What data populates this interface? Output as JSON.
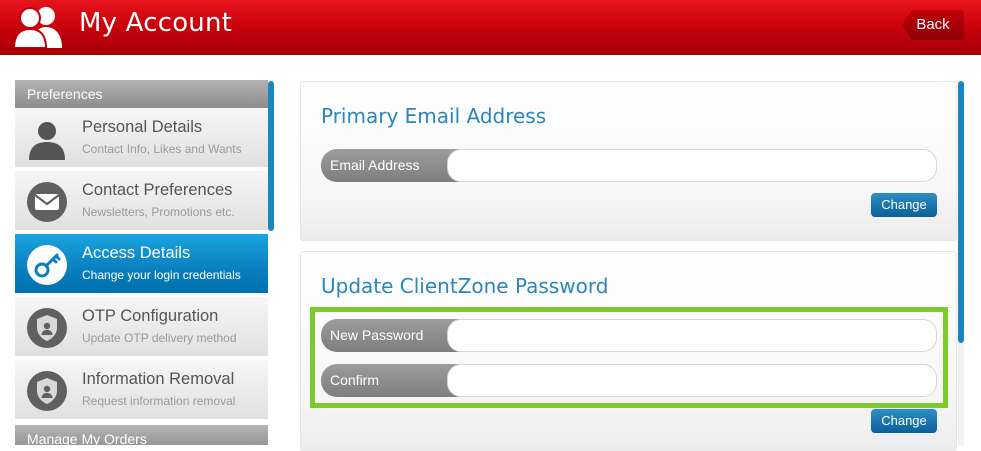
{
  "header": {
    "title": "My Account",
    "icon": "users-icon",
    "back_label": "Back"
  },
  "sidebar": {
    "section_title": "Preferences",
    "items": [
      {
        "label": "Personal Details",
        "sub": "Contact Info, Likes and Wants",
        "icon": "person-icon",
        "active": false
      },
      {
        "label": "Contact Preferences",
        "sub": "Newsletters, Promotions etc.",
        "icon": "envelope-icon",
        "active": false
      },
      {
        "label": "Access Details",
        "sub": "Change your login credentials",
        "icon": "key-icon",
        "active": true
      },
      {
        "label": "OTP Configuration",
        "sub": "Update OTP delivery method",
        "icon": "shield-icon",
        "active": false
      },
      {
        "label": "Information Removal",
        "sub": "Request information removal",
        "icon": "shield-icon",
        "active": false
      }
    ],
    "next_section_title": "Manage My Orders"
  },
  "email_panel": {
    "title": "Primary Email Address",
    "email_label": "Email Address",
    "email_value": "",
    "change_label": "Change"
  },
  "password_panel": {
    "title": "Update ClientZone Password",
    "new_password_label": "New Password",
    "new_password_value": "",
    "confirm_label": "Confirm",
    "confirm_value": "",
    "change_label": "Change"
  },
  "colors": {
    "header_red": "#c4000a",
    "accent_blue": "#1a8fd0",
    "highlight_green": "#7dca2b"
  }
}
